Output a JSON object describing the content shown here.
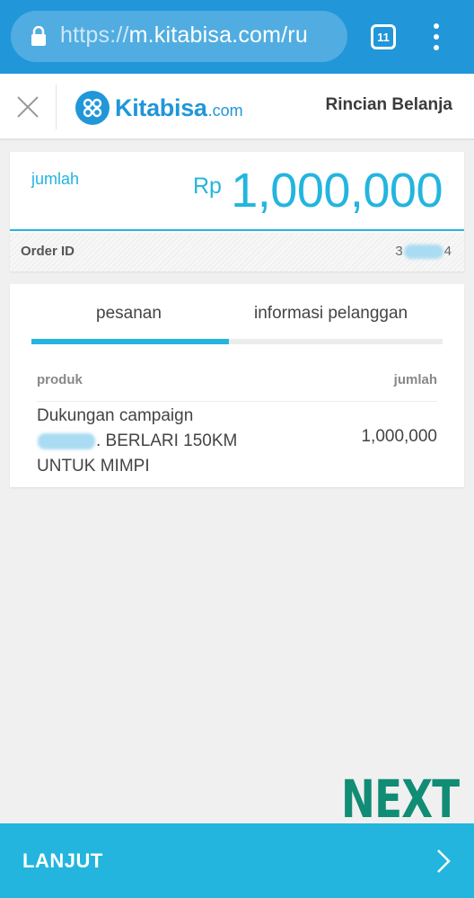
{
  "browser": {
    "url_scheme": "https://",
    "url_host": "m.kitabisa.com/ru",
    "tab_count": "11",
    "icons": {
      "lock": "lock-icon",
      "tabs": "tabs-icon",
      "menu": "more-vert-icon"
    }
  },
  "header": {
    "brand": "Kitabisa",
    "brand_suffix": ".com",
    "title": "Rincian Belanja",
    "icons": {
      "close": "close-icon",
      "logo": "kitabisa-logo-icon"
    }
  },
  "amount": {
    "label": "jumlah",
    "currency": "Rp",
    "value": "1,000,000"
  },
  "order": {
    "label": "Order ID",
    "value_prefix": "3",
    "value_suffix": "4"
  },
  "tabs": [
    {
      "label": "pesanan",
      "active": true
    },
    {
      "label": "informasi pelanggan",
      "active": false
    }
  ],
  "table": {
    "columns": [
      "produk",
      "jumlah"
    ],
    "rows": [
      {
        "product_line1": "Dukungan campaign",
        "product_line2": ". BERLARI 150KM",
        "product_line3": "UNTUK MIMPI",
        "amount": "1,000,000"
      }
    ]
  },
  "overlay": {
    "text": "NEXT"
  },
  "footer": {
    "button_label": "LANJUT",
    "icon": "chevron-right-icon"
  },
  "colors": {
    "browser_blue": "#2196d9",
    "accent": "#23b5de",
    "overlay_green": "#118c75",
    "background": "#f0f0f0"
  }
}
